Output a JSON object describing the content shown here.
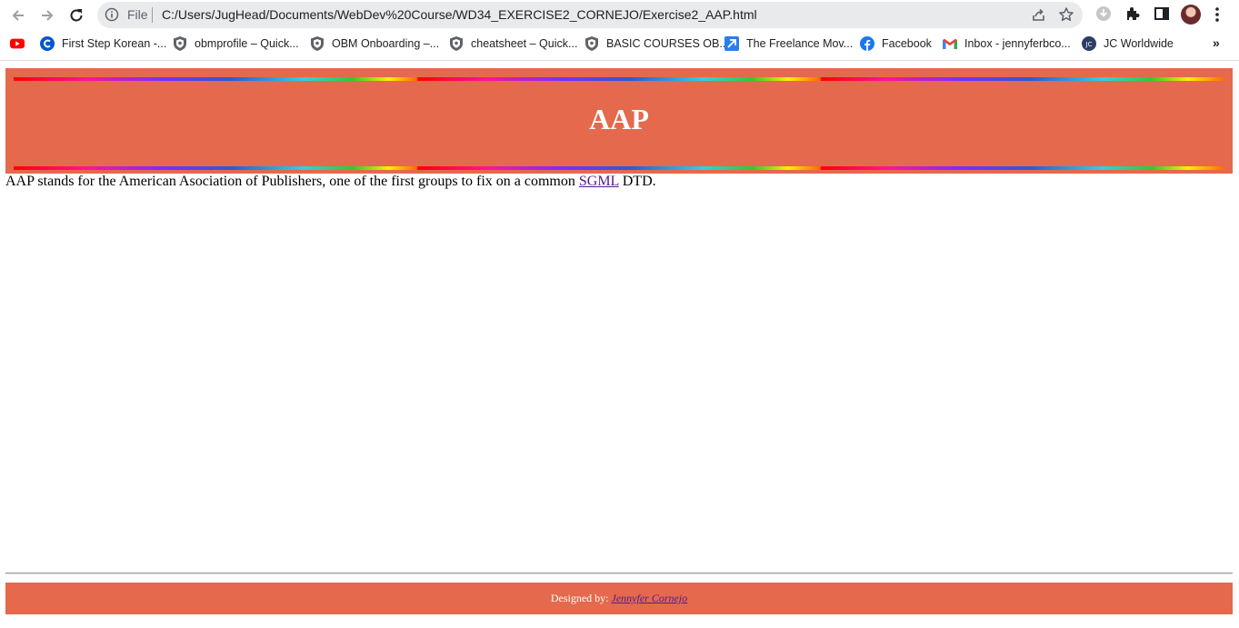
{
  "browser": {
    "omnibox": {
      "scheme_label": "File",
      "url": "C:/Users/JugHead/Documents/WebDev%20Course/WD34_EXERCISE2_CORNEJO/Exercise2_AAP.html"
    },
    "bookmarks": [
      {
        "label": "",
        "icon": "youtube-icon"
      },
      {
        "label": "First Step Korean -...",
        "icon": "coursera-icon"
      },
      {
        "label": "obmprofile – Quick...",
        "icon": "shield-icon"
      },
      {
        "label": "OBM Onboarding –...",
        "icon": "shield-icon"
      },
      {
        "label": "cheatsheet – Quick...",
        "icon": "shield-icon"
      },
      {
        "label": "BASIC COURSES OB...",
        "icon": "shield-icon"
      },
      {
        "label": "The Freelance Mov...",
        "icon": "freelance-icon"
      },
      {
        "label": "Facebook",
        "icon": "facebook-icon"
      },
      {
        "label": "Inbox - jennyferbco...",
        "icon": "gmail-icon"
      },
      {
        "label": "JC Worldwide",
        "icon": "jc-icon"
      }
    ],
    "more_label": "»"
  },
  "page": {
    "title": "AAP",
    "description_before": "AAP stands for the American Asociation of Publishers, one of the first groups to fix on a common ",
    "description_link": "SGML",
    "description_after": " DTD.",
    "footer_prefix": "Designed by: ",
    "footer_link": "Jennyfer Cornejo"
  },
  "colors": {
    "band": "#e5694c",
    "visited_link": "#551a8b"
  }
}
